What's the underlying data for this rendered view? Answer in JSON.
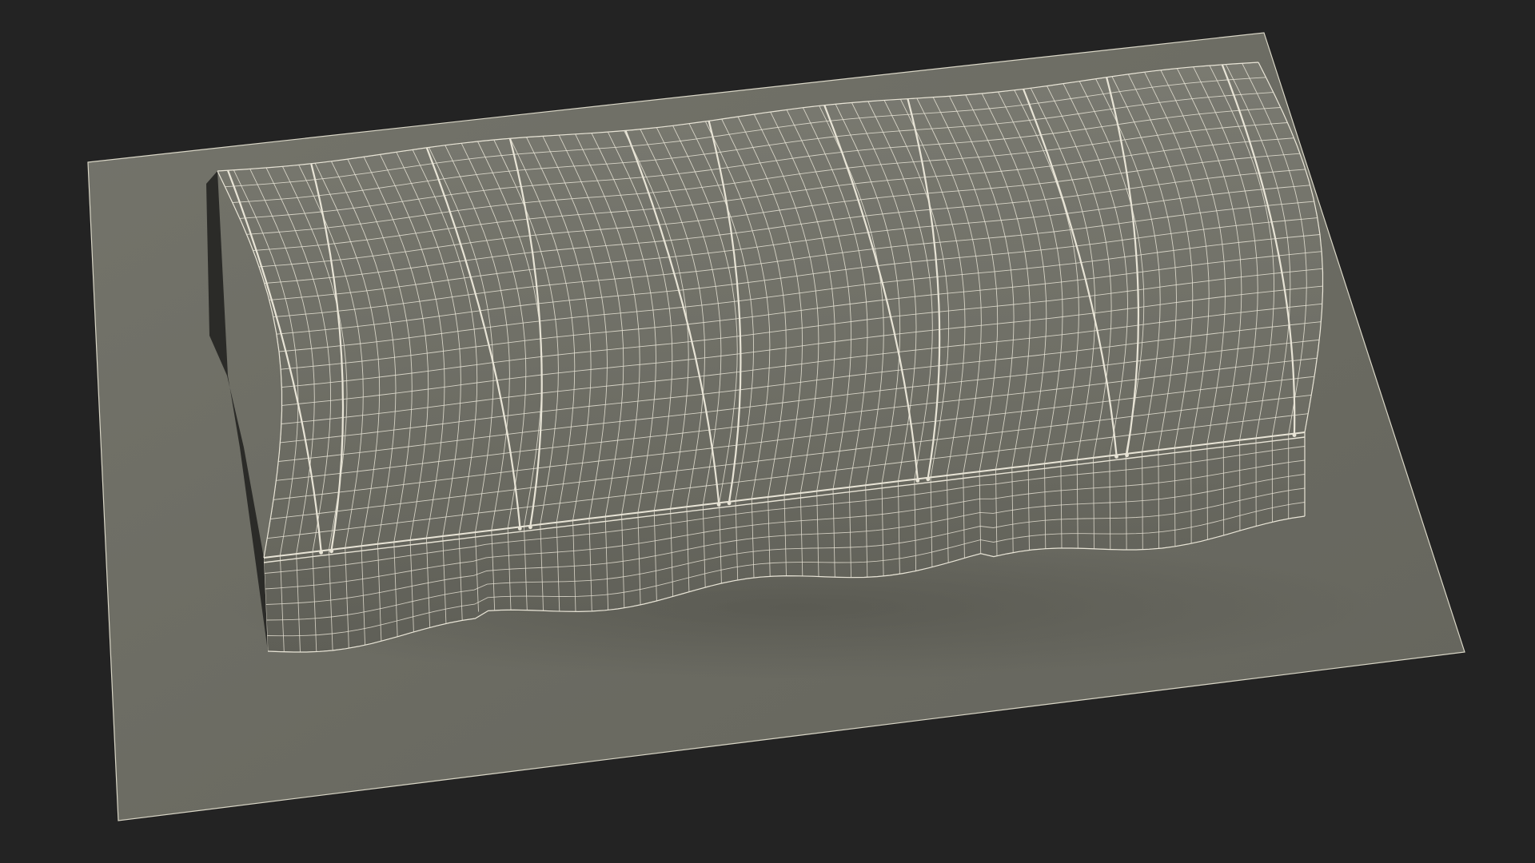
{
  "viewport": {
    "background_color": "#232323"
  },
  "scene": {
    "subject": "arched-tunnel-tent-wireframe",
    "ground_plane_color": "#6d6d64",
    "ground_plane_edge_color": "#d9d6c6",
    "tent_fabric_color": "#6c6c63",
    "wire_color": "#e8e4d6",
    "support_hoop_count": 12
  }
}
